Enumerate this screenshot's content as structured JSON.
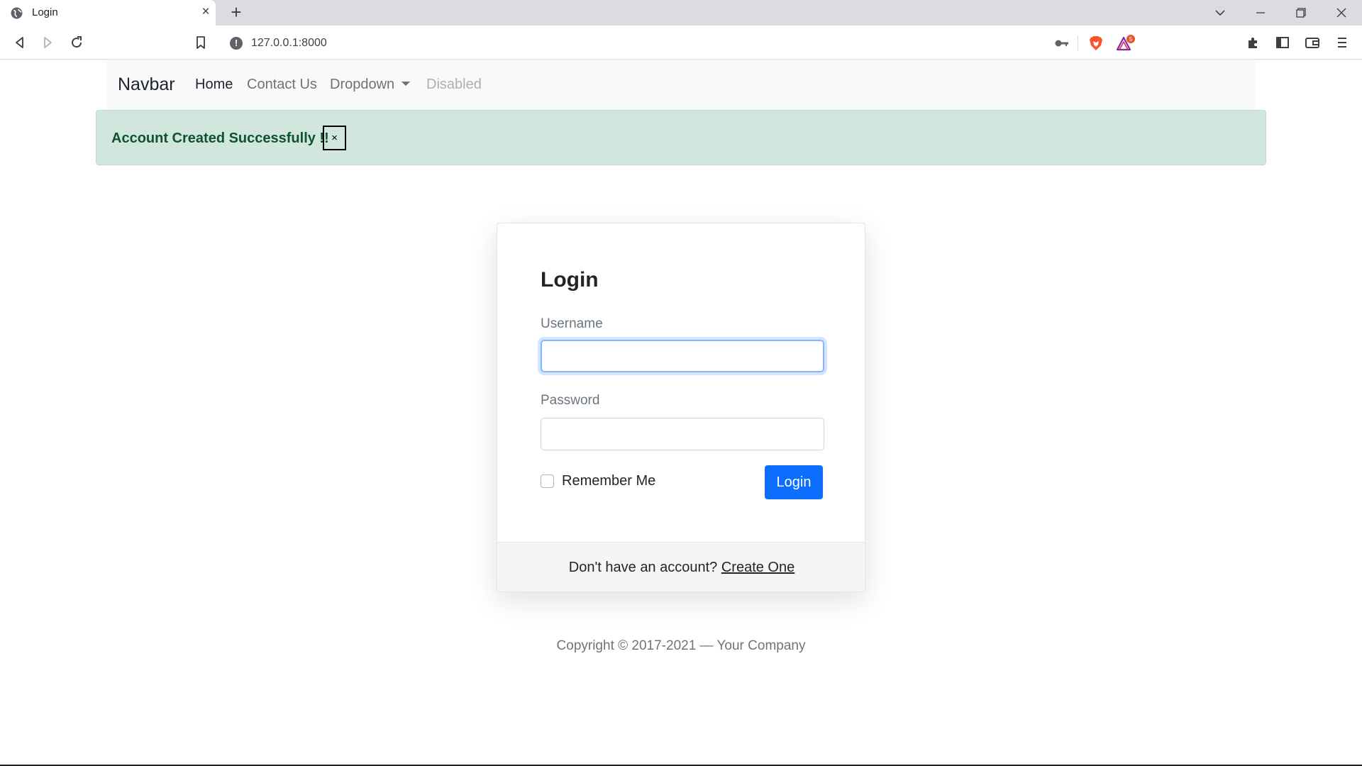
{
  "browser": {
    "tab_title": "Login",
    "tab_close": "×",
    "new_tab": "+",
    "url": "127.0.0.1:8000",
    "info_icon": "!",
    "rewards_badge": "5"
  },
  "navbar": {
    "brand": "Navbar",
    "links": [
      {
        "label": "Home"
      },
      {
        "label": "Contact Us"
      },
      {
        "label": "Dropdown"
      },
      {
        "label": "Disabled"
      }
    ]
  },
  "alert": {
    "message": "Account Created Successfully !!",
    "close": "×",
    "color": "#d1e7dd"
  },
  "login_card": {
    "title": "Login",
    "username_label": "Username",
    "username_value": "",
    "password_label": "Password",
    "password_value": "",
    "remember_label": "Remember Me",
    "submit_label": "Login",
    "footer_prompt": "Don't have an account? ",
    "footer_link": "Create One"
  },
  "footer": {
    "copyright": "Copyright © 2017-2021 — Your Company"
  },
  "colors": {
    "primary": "#0d6efd",
    "alert_text": "#0f5132"
  }
}
